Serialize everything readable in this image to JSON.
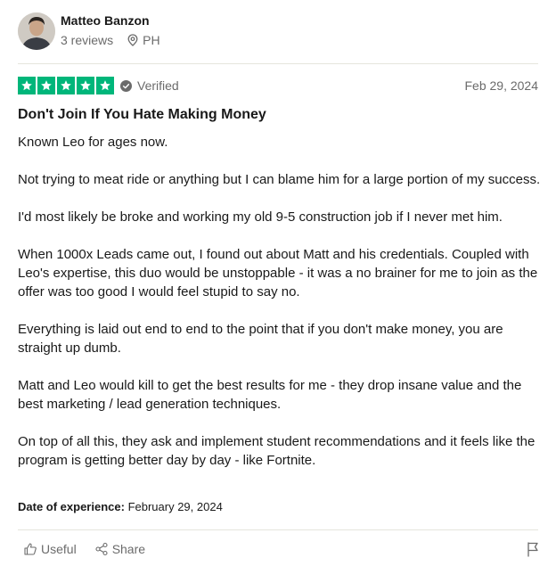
{
  "reviewer": {
    "name": "Matteo Banzon",
    "reviews_count": "3 reviews",
    "location": "PH"
  },
  "review": {
    "rating": 5,
    "rating_max": 5,
    "star_color": "#00b67a",
    "verified_label": "Verified",
    "date": "Feb 29, 2024",
    "title": "Don't Join If You Hate Making Money",
    "paragraphs": [
      "Known Leo for ages now.",
      "Not trying to meat ride or anything but I can blame him for a large portion of my success.",
      "I'd most likely be broke and working my old 9-5 construction job if I never met him.",
      "When 1000x Leads came out, I found out about Matt and his credentials. Coupled with Leo's expertise, this duo would be unstoppable - it was a no brainer for me to join as the offer was too good I would feel stupid to say no.",
      "Everything is laid out end to end to the point that if you don't make money, you are straight up dumb.",
      "Matt and Leo would kill to get the best results for me - they drop insane value and the best marketing / lead generation techniques.",
      "On top of all this, they ask and implement student recommendations and it feels like the program is getting better day by day - like Fortnite."
    ],
    "experience_label": "Date of experience:",
    "experience_date": "February 29, 2024"
  },
  "actions": {
    "useful_label": "Useful",
    "share_label": "Share"
  },
  "icons": {
    "avatar": "avatar-photo",
    "location": "location-pin-icon",
    "verified": "check-circle-icon",
    "useful": "thumbs-up-icon",
    "share": "share-icon",
    "report": "flag-icon"
  }
}
